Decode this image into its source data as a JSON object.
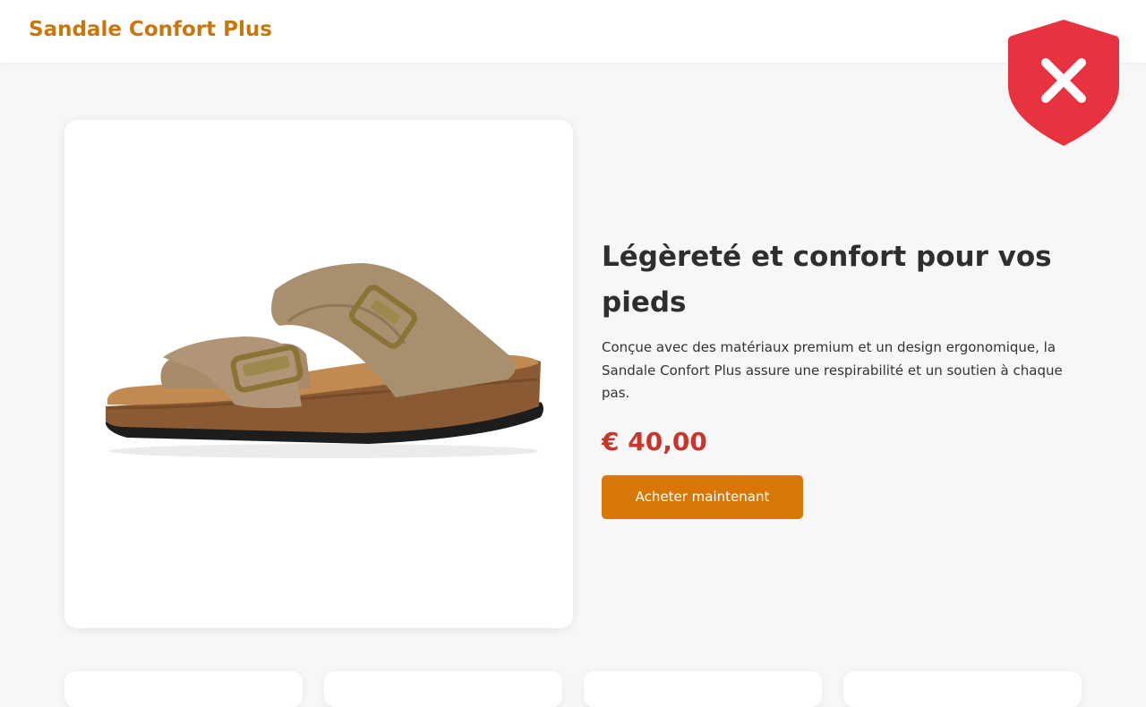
{
  "header": {
    "brand": "Sandale Confort Plus"
  },
  "security_badge": {
    "icon": "shield-x-icon",
    "color": "#e8323f"
  },
  "product": {
    "image_icon": "sandal-product-image",
    "headline": "Légèreté et confort pour vos pieds",
    "description": "Conçue avec des matériaux premium et un design ergonomique, la Sandale Confort Plus assure une respirabilité et un soutien à chaque pas.",
    "price": "€ 40,00",
    "buy_label": "Acheter maintenant"
  },
  "colors": {
    "brand": "#c8770c",
    "price": "#c8352c",
    "button": "#d97706",
    "background": "#f7f7f7"
  }
}
